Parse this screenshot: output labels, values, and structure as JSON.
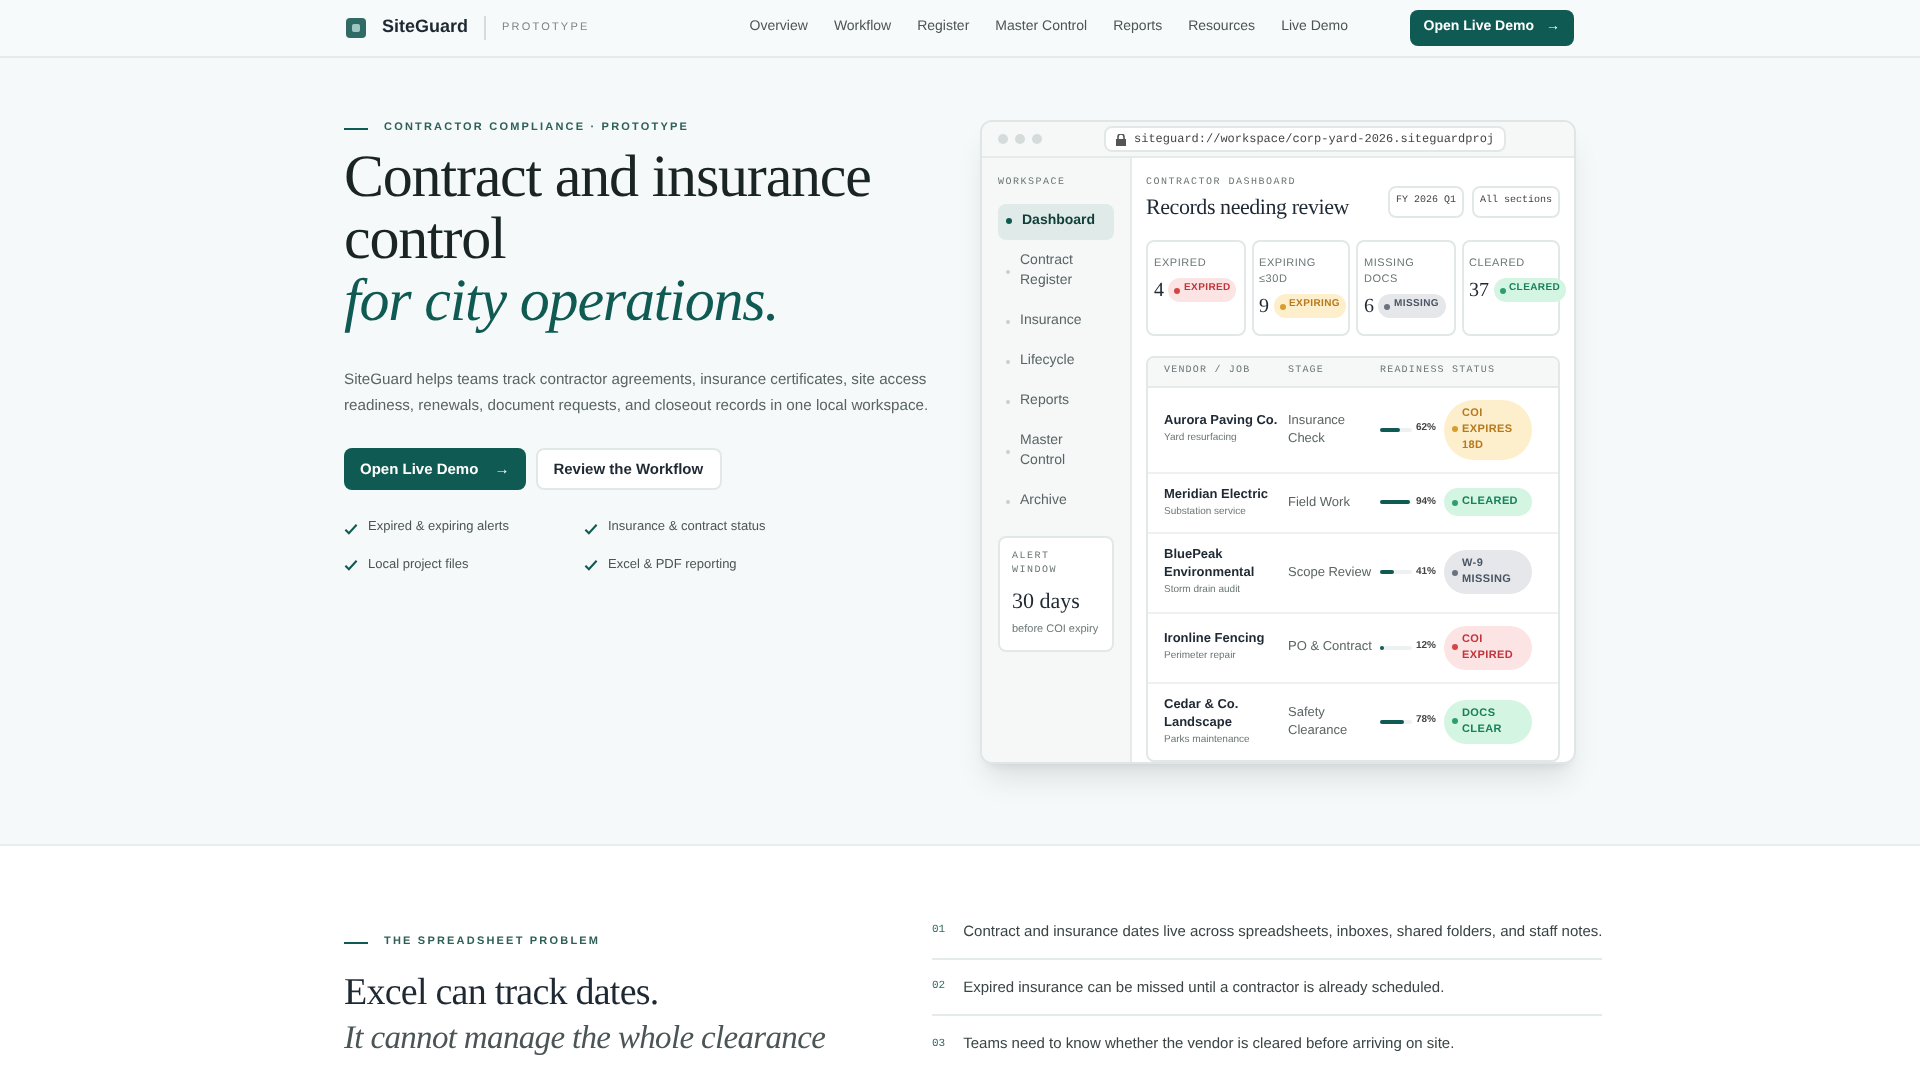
{
  "nav": {
    "brand": "SiteGuard",
    "tag": "PROTOTYPE",
    "links": [
      "Overview",
      "Workflow",
      "Register",
      "Master Control",
      "Reports",
      "Resources",
      "Live Demo"
    ],
    "cta": "Open Live Demo",
    "cta_arrow": "→"
  },
  "hero": {
    "eyebrow": "CONTRACTOR COMPLIANCE · PROTOTYPE",
    "title_lines": [
      "Contract and insurance",
      "control"
    ],
    "title_italic": "for city operations.",
    "body": "SiteGuard helps teams track contractor agreements, insurance certificates, site access readiness, renewals, document requests, and closeout records in one local workspace.",
    "primary": "Open Live Demo",
    "primary_arrow": "→",
    "secondary": "Review the Workflow",
    "features": [
      "Expired & expiring alerts",
      "Insurance & contract status",
      "Local project files",
      "Excel & PDF reporting"
    ]
  },
  "app": {
    "url": "siteguard://workspace/corp-yard-2026.siteguardproj",
    "sidebar_title": "WORKSPACE",
    "sidebar_items": [
      {
        "label": "Dashboard",
        "selected": true
      },
      {
        "label": "Contract Register",
        "selected": false
      },
      {
        "label": "Insurance",
        "selected": false
      },
      {
        "label": "Lifecycle",
        "selected": false
      },
      {
        "label": "Reports",
        "selected": false
      },
      {
        "label": "Master Control",
        "selected": false
      },
      {
        "label": "Archive",
        "selected": false
      }
    ],
    "alert": {
      "title": "ALERT WINDOW",
      "value": "30 days",
      "caption": "before COI expiry"
    },
    "eyebrow": "CONTRACTOR DASHBOARD",
    "heading": "Records needing review",
    "filters": [
      "FY 2026 Q1",
      "All sections"
    ],
    "stats": [
      {
        "label": "EXPIRED",
        "count": "4",
        "badge": "EXPIRED",
        "kind": "expired"
      },
      {
        "label": "EXPIRING ≤30D",
        "count": "9",
        "badge": "EXPIRING",
        "kind": "expiring"
      },
      {
        "label": "MISSING DOCS",
        "count": "6",
        "badge": "MISSING",
        "kind": "missing"
      },
      {
        "label": "CLEARED",
        "count": "37",
        "badge": "CLEARED",
        "kind": "cleared"
      }
    ],
    "table": {
      "columns": [
        "VENDOR / JOB",
        "STAGE",
        "READINESS",
        "STATUS"
      ],
      "rows": [
        {
          "vendor": "Aurora Paving Co.",
          "job": "Yard resurfacing",
          "stage": "Insurance Check",
          "level": 0.62,
          "reading": "62%",
          "status": "COI EXPIRES 18D",
          "kind": "expiring"
        },
        {
          "vendor": "Meridian Electric",
          "job": "Substation service",
          "stage": "Field Work",
          "level": 0.94,
          "reading": "94%",
          "status": "CLEARED",
          "kind": "cleared"
        },
        {
          "vendor": "BluePeak Environmental",
          "job": "Storm drain audit",
          "stage": "Scope Review",
          "level": 0.41,
          "reading": "41%",
          "status": "W-9 MISSING",
          "kind": "missing"
        },
        {
          "vendor": "Ironline Fencing",
          "job": "Perimeter repair",
          "stage": "PO & Contract",
          "level": 0.12,
          "reading": "12%",
          "status": "COI EXPIRED",
          "kind": "expired"
        },
        {
          "vendor": "Cedar & Co. Landscape",
          "job": "Parks maintenance",
          "stage": "Safety Clearance",
          "level": 0.78,
          "reading": "78%",
          "status": "DOCS CLEAR",
          "kind": "cleared"
        }
      ]
    }
  },
  "problem": {
    "eyebrow": "THE SPREADSHEET PROBLEM",
    "title": "Excel can track dates.",
    "subtitle": "It cannot manage the whole clearance",
    "points": [
      {
        "num": "01",
        "text": "Contract and insurance dates live across spreadsheets, inboxes, shared folders, and staff notes."
      },
      {
        "num": "02",
        "text": "Expired insurance can be missed until a contractor is already scheduled."
      },
      {
        "num": "03",
        "text": "Teams need to know whether the vendor is cleared before arriving on site."
      }
    ]
  }
}
